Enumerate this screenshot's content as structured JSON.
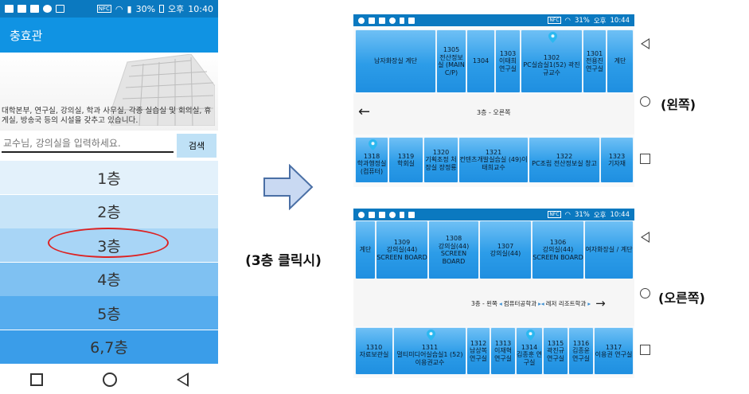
{
  "left_phone": {
    "status": {
      "battery": "30%",
      "ampm": "오후",
      "time": "10:40",
      "nfc": "NFC"
    },
    "title": "충효관",
    "description": "대학본부, 연구실, 강의실, 학과 사무실, 각종 실습실 및 회의실, 휴게실, 방송국 등의 시설을 갖추고 있습니다.",
    "search": {
      "placeholder": "교수님, 강의실을 입력하세요.",
      "button": "검색"
    },
    "floors": [
      {
        "label": "1층",
        "color": "#e3f1fb"
      },
      {
        "label": "2층",
        "color": "#c7e4f8"
      },
      {
        "label": "3층",
        "color": "#a8d5f6"
      },
      {
        "label": "4층",
        "color": "#7fc1f2"
      },
      {
        "label": "5층",
        "color": "#55acee"
      },
      {
        "label": "6,7층",
        "color": "#3a9de9"
      }
    ]
  },
  "center": {
    "caption": "(3층 클릭시)"
  },
  "top_phone": {
    "status": {
      "battery": "31%",
      "ampm": "오후",
      "time": "10:44",
      "nfc": "NFC"
    },
    "top_rooms": [
      {
        "num": "",
        "name": "남자화장실 계단"
      },
      {
        "num": "1305",
        "name": "전산정보실 (MAIN C/P)"
      },
      {
        "num": "1304",
        "name": ""
      },
      {
        "num": "1303",
        "name": "이태희 연구실"
      },
      {
        "num": "1302",
        "name": "PC실습실1(52) 곽진규교수"
      },
      {
        "num": "1301",
        "name": "전용진 연구실"
      },
      {
        "num": "",
        "name": "계단"
      }
    ],
    "hall_text": "3층 - 오른쪽",
    "bottom_rooms": [
      {
        "num": "1318",
        "name": "학과행정실 (컴퓨터)"
      },
      {
        "num": "1319",
        "name": "학회실"
      },
      {
        "num": "1320",
        "name": "기획조정 처장실 장정룡"
      },
      {
        "num": "1321",
        "name": "컨텐츠개발실습실 (49)이태희교수"
      },
      {
        "num": "1322",
        "name": "PC조립 전산정보실 창고"
      },
      {
        "num": "1323",
        "name": "기자재"
      }
    ],
    "side_label": "(왼쪽)"
  },
  "bottom_phone": {
    "status": {
      "battery": "31%",
      "ampm": "오후",
      "time": "10:44",
      "nfc": "NFC"
    },
    "top_rooms": [
      {
        "num": "",
        "name": "계단"
      },
      {
        "num": "1309",
        "name": "강의실(44) SCREEN BOARD"
      },
      {
        "num": "1308",
        "name": "강의실(44) SCREEN BOARD"
      },
      {
        "num": "1307",
        "name": "강의실(44)"
      },
      {
        "num": "1306",
        "name": "강의실(44) SCREEN BOARD"
      },
      {
        "num": "",
        "name": "여자화장실 / 계단"
      }
    ],
    "hall_text": "3층 - 왼쪽",
    "hall_links": [
      "컴퓨터공학과",
      "레저 리조트학과"
    ],
    "bottom_rooms": [
      {
        "num": "1310",
        "name": "자료보관실"
      },
      {
        "num": "1311",
        "name": "멀티미디어실습실1 (52) 이용권교수"
      },
      {
        "num": "1312",
        "name": "남상복 연구실"
      },
      {
        "num": "1313",
        "name": "이재혁 연구실"
      },
      {
        "num": "1314",
        "name": "김종훈 연구실"
      },
      {
        "num": "1315",
        "name": "곽진규 연구실"
      },
      {
        "num": "1316",
        "name": "김종윤 연구실"
      },
      {
        "num": "1317",
        "name": "이용권 연구실"
      }
    ],
    "side_label": "(오른쪽)"
  }
}
